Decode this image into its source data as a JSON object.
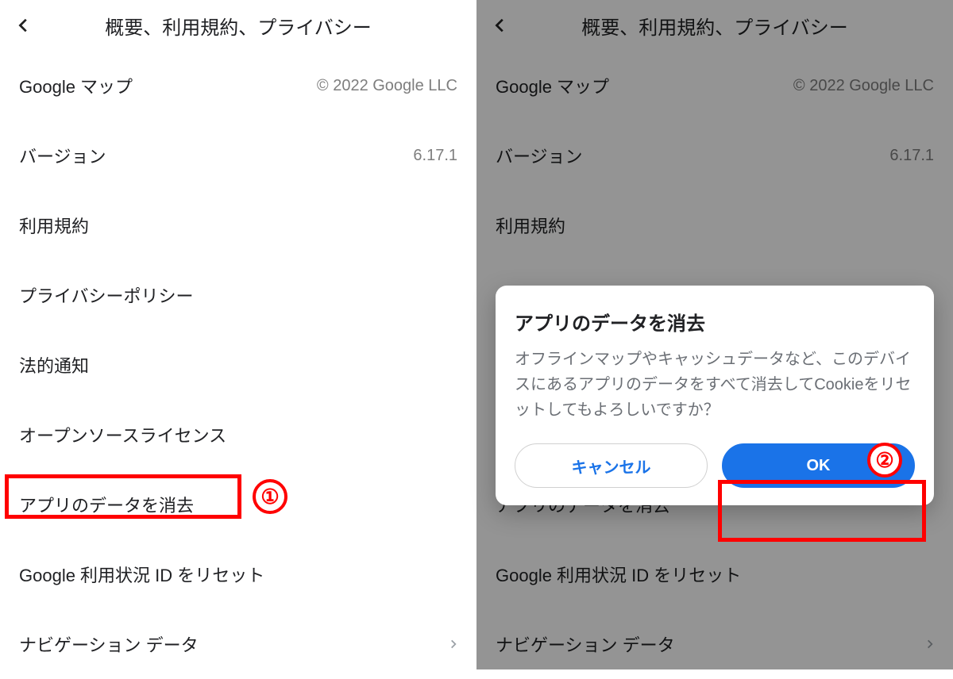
{
  "header": {
    "title": "概要、利用規約、プライバシー"
  },
  "rows": {
    "app_name_label": "Google マップ",
    "copyright": "© 2022 Google LLC",
    "version_label": "バージョン",
    "version_value": "6.17.1",
    "terms": "利用規約",
    "privacy": "プライバシーポリシー",
    "legal": "法的通知",
    "oss": "オープンソースライセンス",
    "clear_data": "アプリのデータを消去",
    "reset_usage_id": "Google 利用状況 ID をリセット",
    "nav_data": "ナビゲーション データ"
  },
  "dialog": {
    "title": "アプリのデータを消去",
    "body": "オフラインマップやキャッシュデータなど、このデバイスにあるアプリのデータをすべて消去してCookieをリセットしてもよろしいですか？",
    "cancel": "キャンセル",
    "ok": "OK"
  },
  "annotations": {
    "step1": "①",
    "step2": "②"
  }
}
